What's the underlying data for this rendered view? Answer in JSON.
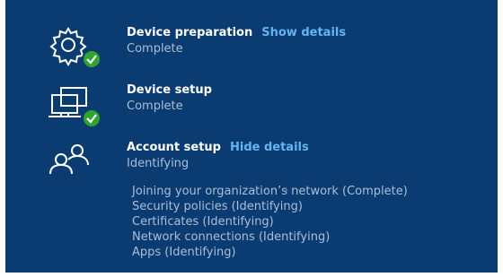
{
  "steps": [
    {
      "title": "Device preparation",
      "link": "Show details",
      "status": "Complete",
      "icon": "gear-check-icon"
    },
    {
      "title": "Device setup",
      "link": "",
      "status": "Complete",
      "icon": "device-check-icon"
    },
    {
      "title": "Account setup",
      "link": "Hide details",
      "status": "Identifying",
      "icon": "people-icon"
    }
  ],
  "account_details": [
    "Joining your organization’s network (Complete)",
    "Security policies (Identifying)",
    "Certificates (Identifying)",
    "Network connections (Identifying)",
    "Apps (Identifying)"
  ],
  "colors": {
    "background": "#0a3c71",
    "link": "#63b4f0",
    "check": "#2fa52f",
    "muted": "#a9bfd8"
  }
}
